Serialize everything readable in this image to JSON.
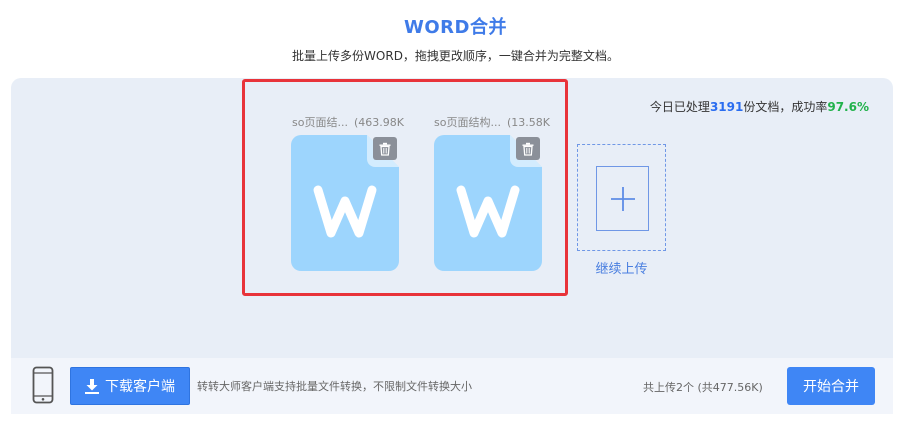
{
  "header": {
    "title": "WORD合并",
    "subtitle": "批量上传多份WORD，拖拽更改顺序，一键合并为完整文档。"
  },
  "stats": {
    "prefix": "今日已处理",
    "count": "3191",
    "middle": "份文档，成功率",
    "rate": "97.6%"
  },
  "files": [
    {
      "name": "so页面结...",
      "size": "(463.98K",
      "icon": "word-doc-icon"
    },
    {
      "name": "so页面结构...",
      "size": "(13.58K",
      "icon": "word-doc-icon"
    }
  ],
  "add": {
    "label": "继续上传",
    "icon": "plus-icon"
  },
  "footer": {
    "download_label": "下载客户端",
    "note": "转转大师客户端支持批量文件转换，不限制文件转换大小",
    "upload_count": "共上传2个 (共477.56K)",
    "merge_label": "开始合并"
  },
  "colors": {
    "accent": "#3f86f5",
    "title": "#3f7be8",
    "highlight": "#e8333a",
    "doc_fill": "#9dd5fd",
    "success": "#22b24c"
  }
}
